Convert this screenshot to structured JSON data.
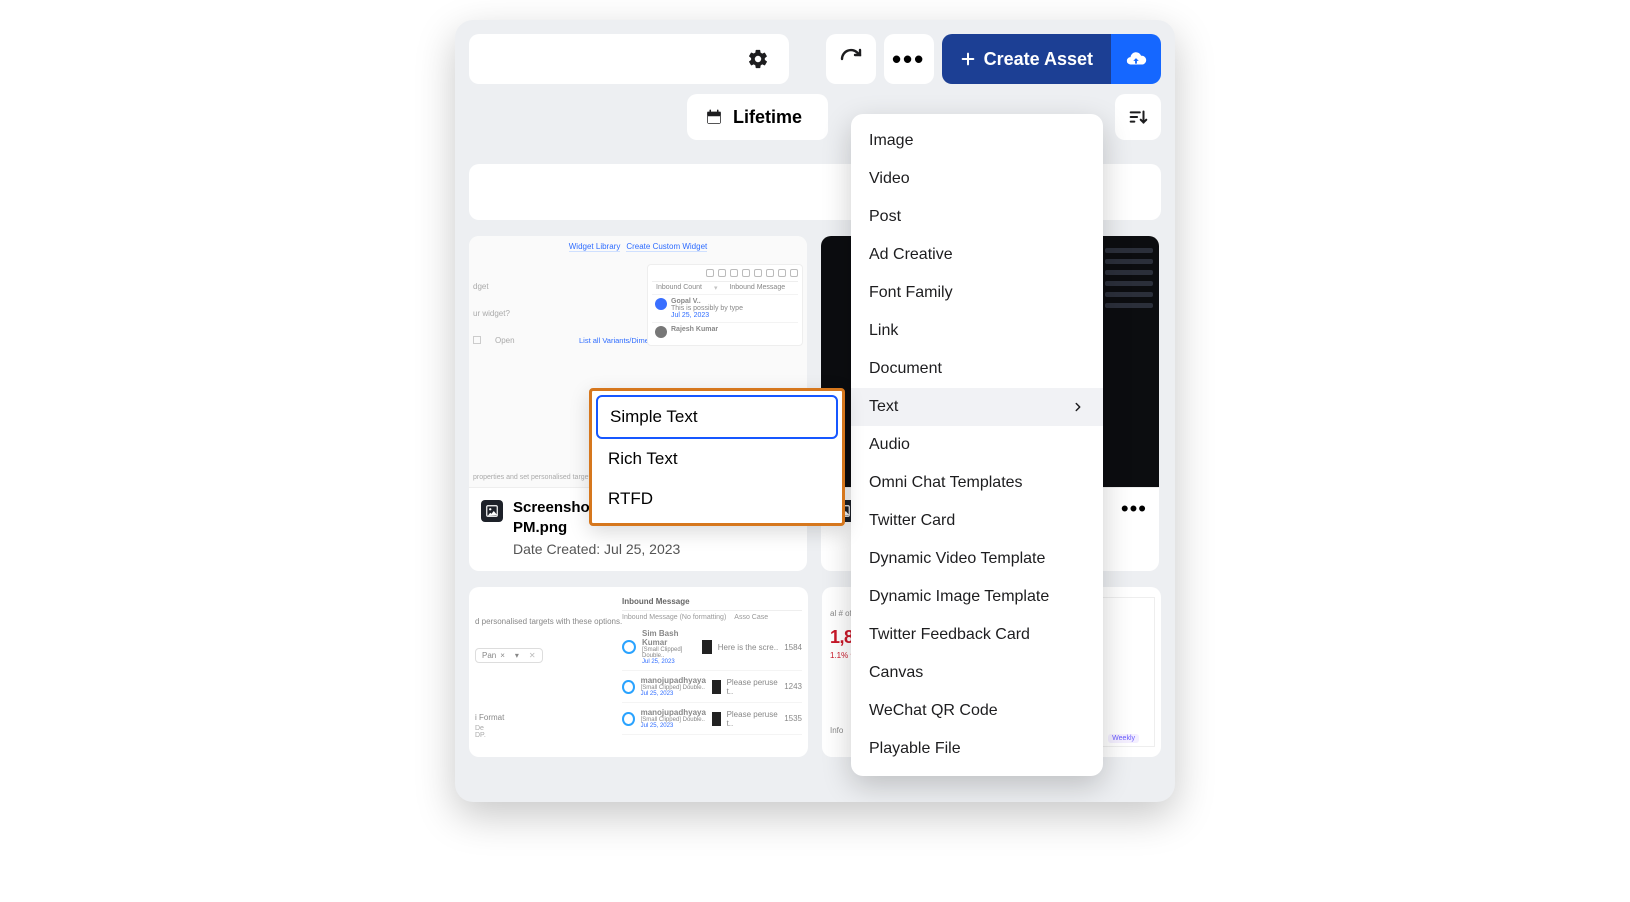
{
  "toolbar": {
    "create_label": "Create Asset"
  },
  "filter": {
    "lifetime_label": "Lifetime"
  },
  "create_menu": {
    "items": [
      "Image",
      "Video",
      "Post",
      "Ad Creative",
      "Font Family",
      "Link",
      "Document",
      "Text",
      "Audio",
      "Omni Chat Templates",
      "Twitter Card",
      "Dynamic Video Template",
      "Dynamic Image Template",
      "Twitter Feedback Card",
      "Canvas",
      "WeChat QR Code",
      "Playable File"
    ],
    "hover_index": 7
  },
  "text_submenu": {
    "items": [
      "Simple Text",
      "Rich Text",
      "RTFD"
    ],
    "selected_index": 0
  },
  "card1": {
    "title": "Screenshot 2023-07-25 at 1.15.11 PM.png",
    "subtitle": "Date Created: Jul 25, 2023",
    "preview": {
      "tabs": [
        "Widget Library",
        "Create Custom Widget"
      ],
      "left_label_1": "dget",
      "left_label_2": "ur widget?",
      "row_icon": "Open",
      "side_cols": [
        "Inbound Count",
        "Inbound Message"
      ],
      "link": "List all Variants/Dimensions",
      "msg1_name": "Gopal V..",
      "msg1_line": "This is possibly by type",
      "msg1_date": "Jul 25, 2023",
      "msg2_name": "Rajesh Kumar",
      "bottom": "properties and set personalised targets with these options."
    }
  },
  "card2_row": {
    "left": {
      "text": "d personalised targets with these options.",
      "pill": "Pan",
      "format_label": "i Format",
      "panel_headers": [
        "Inbound Message",
        "Inbound Message (No formatting)",
        "Asso Case"
      ],
      "rows": [
        {
          "name": "Sim Bash Kumar",
          "sub": "[Small Clipped] Double..",
          "date": "Jul 25, 2023",
          "msg": "Here is the scre..",
          "num": "1584"
        },
        {
          "name": "manojupadhyaya",
          "sub": "[Small Clipped] Double..",
          "date": "Jul 25, 2023",
          "msg": "Please peruse t..",
          "num": "1243"
        },
        {
          "name": "manojupadhyaya",
          "sub": "[Small Clipped] Double..",
          "date": "Jul 25, 2023",
          "msg": "Please peruse t..",
          "num": "1535"
        }
      ]
    },
    "right": {
      "label": "al # of C",
      "big": "1,81",
      "pct": "1.1%",
      "label2": "Info",
      "tag": "Weekly"
    }
  }
}
